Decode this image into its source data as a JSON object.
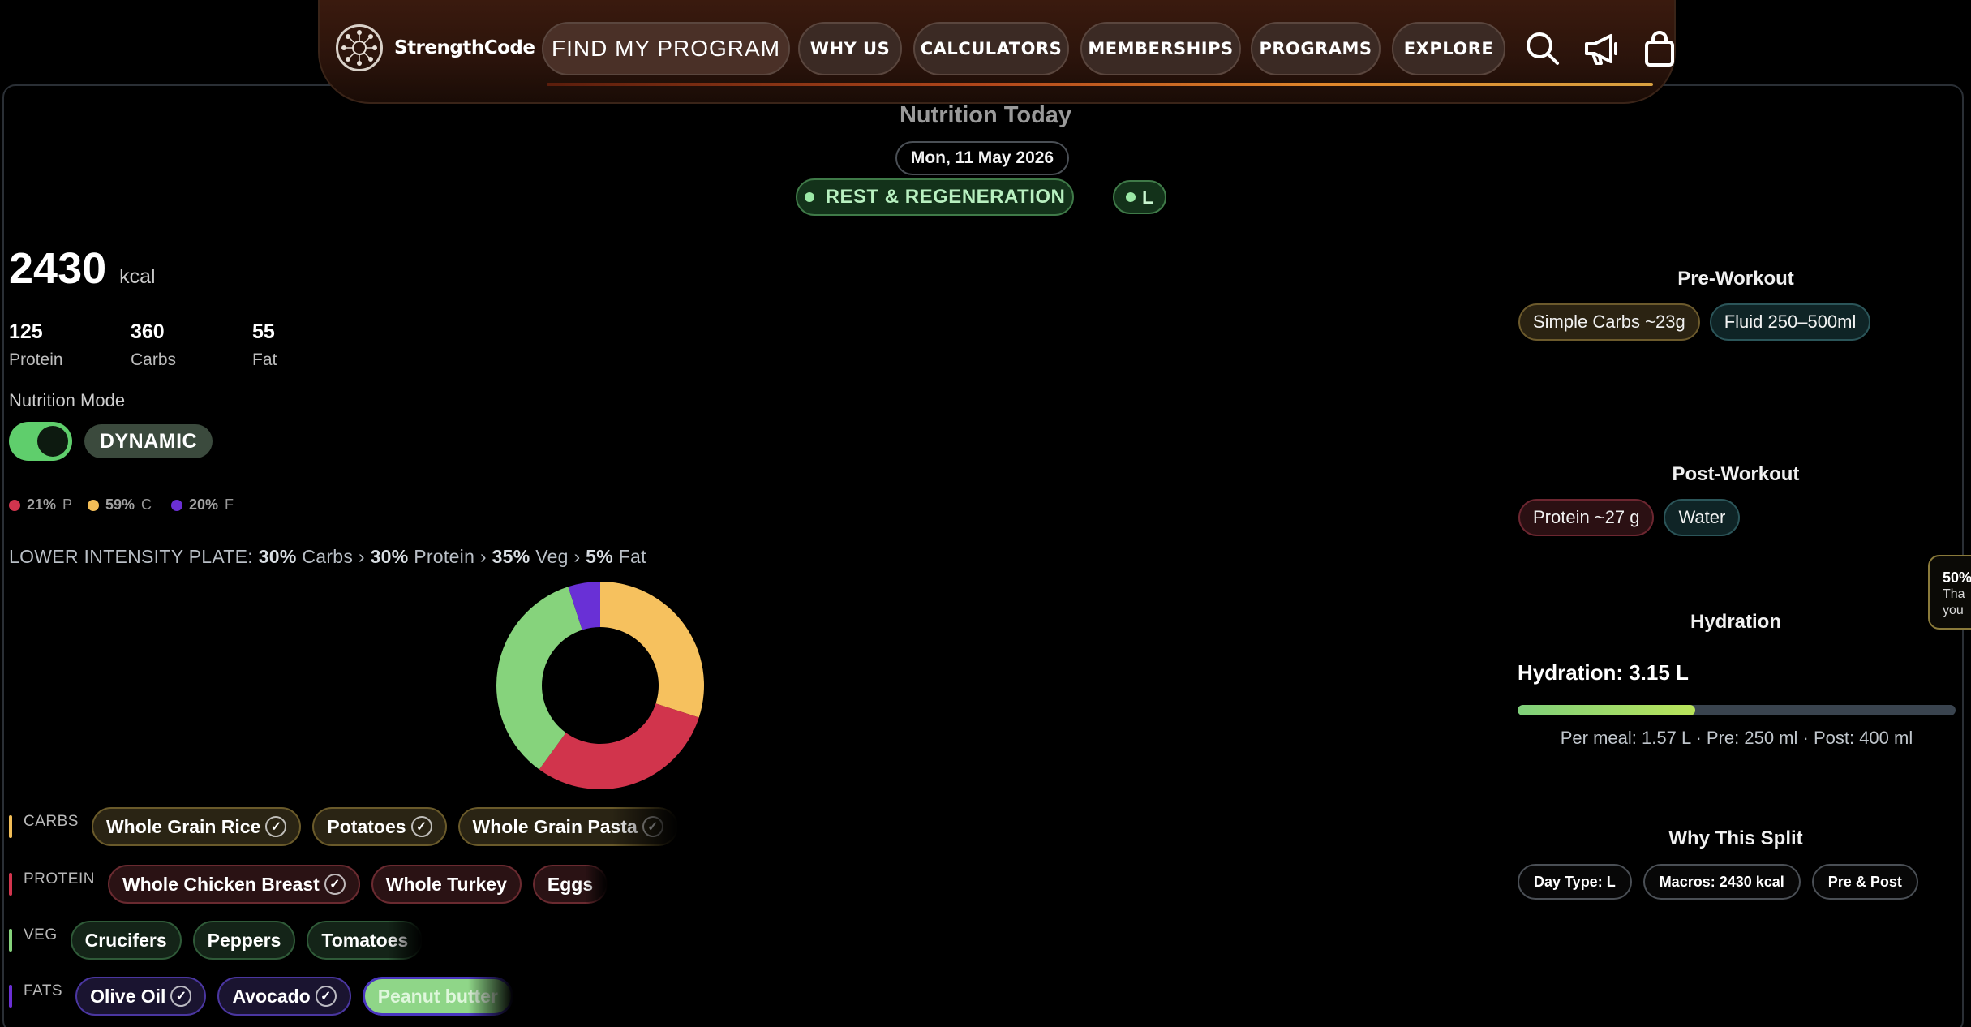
{
  "nav": {
    "brand": "StrengthCode",
    "find_program": "FIND MY PROGRAM",
    "why_us": "WHY US",
    "calculators": "CALCULATORS",
    "memberships": "MEMBERSHIPS",
    "programs": "PROGRAMS",
    "explore": "EXPLORE",
    "icons": [
      "search-icon",
      "megaphone-icon",
      "shopping-bag-icon"
    ],
    "accent": "#e0862b"
  },
  "header": {
    "title": "Nutrition Today",
    "date": "Mon, 11 May 2026",
    "day_type": "REST & REGENERATION",
    "day_code": "L"
  },
  "summary": {
    "kcal": "2430",
    "kcal_unit": "kcal",
    "macros": [
      {
        "value": "125",
        "label": "Protein"
      },
      {
        "value": "360",
        "label": "Carbs"
      },
      {
        "value": "55",
        "label": "Fat"
      }
    ],
    "mode_label": "Nutrition Mode",
    "mode_on": true,
    "mode_value": "DYNAMIC"
  },
  "split_legend": [
    {
      "pct": "21%",
      "letter": "P",
      "color": "#d2354e"
    },
    {
      "pct": "59%",
      "letter": "C",
      "color": "#f2bd57"
    },
    {
      "pct": "20%",
      "letter": "F",
      "color": "#6b2fd4"
    }
  ],
  "plate": {
    "prefix": "LOWER INTENSITY PLATE:",
    "items": [
      {
        "pct": "30%",
        "name": "Carbs"
      },
      {
        "pct": "30%",
        "name": "Protein"
      },
      {
        "pct": "35%",
        "name": "Veg"
      },
      {
        "pct": "5%",
        "name": "Fat"
      }
    ],
    "separator": "›",
    "donut": [
      {
        "name": "Carbs",
        "value": 30,
        "color": "#f6c15e"
      },
      {
        "name": "Protein",
        "value": 30,
        "color": "#d1344c"
      },
      {
        "name": "Veg",
        "value": 35,
        "color": "#86d37c"
      },
      {
        "name": "Fat",
        "value": 5,
        "color": "#6930d6"
      }
    ]
  },
  "foods": {
    "carbs": {
      "label": "CARBS",
      "items": [
        "Whole Grain Rice",
        "Potatoes",
        "Whole Grain Pasta"
      ]
    },
    "protein": {
      "label": "PROTEIN",
      "items": [
        "Whole Chicken Breast",
        "Whole Turkey",
        "Eggs"
      ]
    },
    "veg": {
      "label": "VEG",
      "items": [
        "Crucifers",
        "Peppers",
        "Tomatoes"
      ]
    },
    "fats": {
      "label": "FATS",
      "items": [
        "Olive Oil",
        "Avocado",
        "Peanut butter"
      ]
    }
  },
  "right": {
    "pre_title": "Pre-Workout",
    "pre_chips": [
      "Simple Carbs ~23g",
      "Fluid 250–500ml"
    ],
    "post_title": "Post-Workout",
    "post_chips": [
      "Protein ~27 g",
      "Water"
    ],
    "hyd_title": "Hydration",
    "hyd_label": "Hydration: 3.15 L",
    "hyd_progress": 0.405,
    "hyd_sub": "Per meal: 1.57 L · Pre: 250 ml · Post: 400 ml",
    "why_title": "Why This Split",
    "why_chips": [
      "Day Type: L",
      "Macros: 2430 kcal",
      "Pre & Post"
    ]
  },
  "side_tab": {
    "pct": "50%",
    "line1": "Tha",
    "line2": "you"
  }
}
